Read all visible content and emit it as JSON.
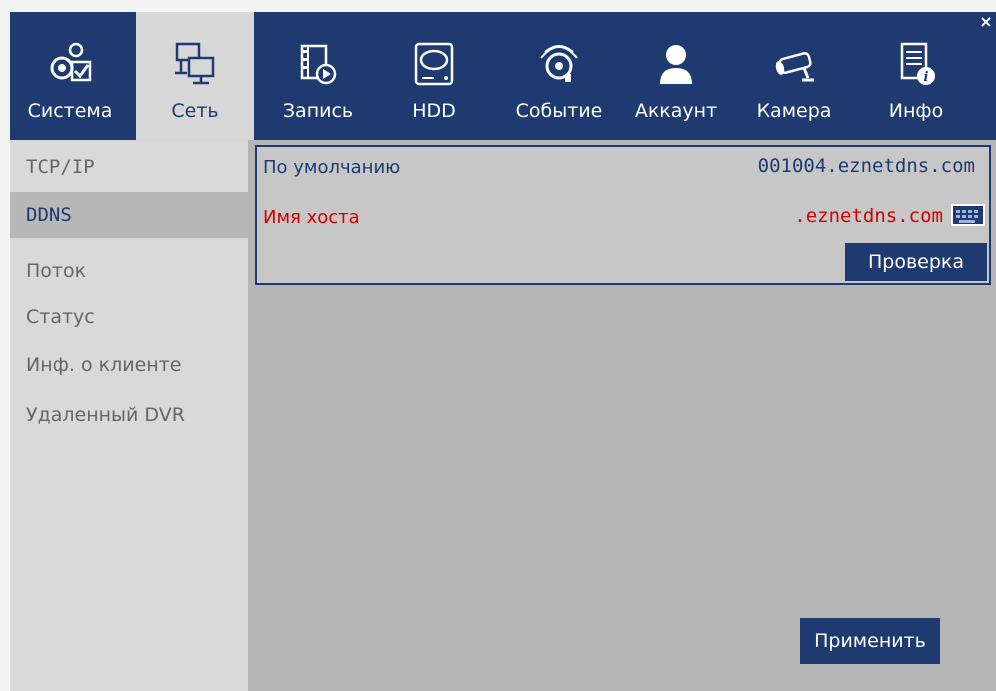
{
  "window": {
    "close_glyph": "×"
  },
  "tabs": [
    {
      "label": "Система",
      "icon": "gear-check-icon"
    },
    {
      "label": "Сеть",
      "icon": "network-monitors-icon",
      "active": true
    },
    {
      "label": "Запись",
      "icon": "film-play-icon"
    },
    {
      "label": "HDD",
      "icon": "hard-drive-icon"
    },
    {
      "label": "Событие",
      "icon": "alarm-bell-icon"
    },
    {
      "label": "Аккаунт",
      "icon": "user-icon"
    },
    {
      "label": "Камера",
      "icon": "bullet-camera-icon"
    },
    {
      "label": "Инфо",
      "icon": "document-info-icon"
    }
  ],
  "sidebar": {
    "items": [
      {
        "label": "TCP/IP"
      },
      {
        "label": "DDNS",
        "active": true
      },
      {
        "label": "Поток"
      },
      {
        "label": "Статус"
      },
      {
        "label": "Инф. о клиенте"
      },
      {
        "label": "Удаленный DVR"
      }
    ]
  },
  "ddns": {
    "default_label": "По умолчанию",
    "default_value": "001004.eznetdns.com",
    "hostname_label": "Имя хоста",
    "hostname_value": ".eznetdns.com",
    "check_button": "Проверка"
  },
  "apply_button": "Применить",
  "colors": {
    "accent": "#1f3a70",
    "highlight_text": "#d40000",
    "panel_bg": "#b5b5b5",
    "sidebar_bg": "#d9d9d9"
  }
}
